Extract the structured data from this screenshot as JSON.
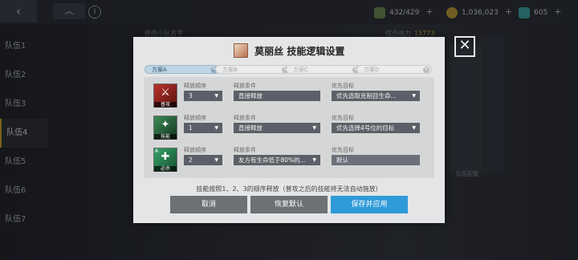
{
  "topbar": {
    "back_icon": "‹",
    "home_icon": "︿",
    "info_icon": "i",
    "resources": [
      {
        "icon": "cash-icon",
        "color": "#6a8f4e",
        "value": "432/429"
      },
      {
        "icon": "coin-icon",
        "color": "#c9a032",
        "value": "1,036,023"
      },
      {
        "icon": "gem-icon",
        "color": "#3ea6a6",
        "value": "605"
      }
    ],
    "plus": "+"
  },
  "teams": [
    "队伍1",
    "队伍2",
    "队伍3",
    "队伍4",
    "队伍5",
    "队伍6",
    "队伍7"
  ],
  "background": {
    "team_name_placeholder": "修改小队名字",
    "score_label": "综合战力",
    "score_value": "15773",
    "config_label": "队伍配置"
  },
  "dialog": {
    "close_icon": "✕",
    "title": "莫丽丝  技能逻辑设置",
    "tabs": [
      {
        "label": "方案A",
        "active": true
      },
      {
        "label": "方案B",
        "active": false
      },
      {
        "label": "方案C",
        "active": false
      },
      {
        "label": "方案D",
        "active": false
      }
    ],
    "pen_icon": "✎",
    "col_order": "释放顺序",
    "col_condition": "释放条件",
    "col_target": "优先目标",
    "skills": [
      {
        "tag": "普攻",
        "glyph": "⚔",
        "corner": "",
        "order": "3",
        "condition": "直接释放",
        "target": "优先选取克制目生命..."
      },
      {
        "tag": "技能",
        "glyph": "✦",
        "corner": "",
        "order": "1",
        "condition": "直接释放",
        "target": "优先选择4号位的目标"
      },
      {
        "tag": "必杀",
        "glyph": "✚",
        "corner": "A",
        "order": "2",
        "condition": "友方有生命低于80%的...",
        "target": "默认"
      }
    ],
    "hint": "技能按照1、2、3的顺序释放（普攻之后的技能将无法自动施放）",
    "buttons": {
      "cancel": "取消",
      "reset": "恢复默认",
      "save": "保存并应用"
    }
  }
}
